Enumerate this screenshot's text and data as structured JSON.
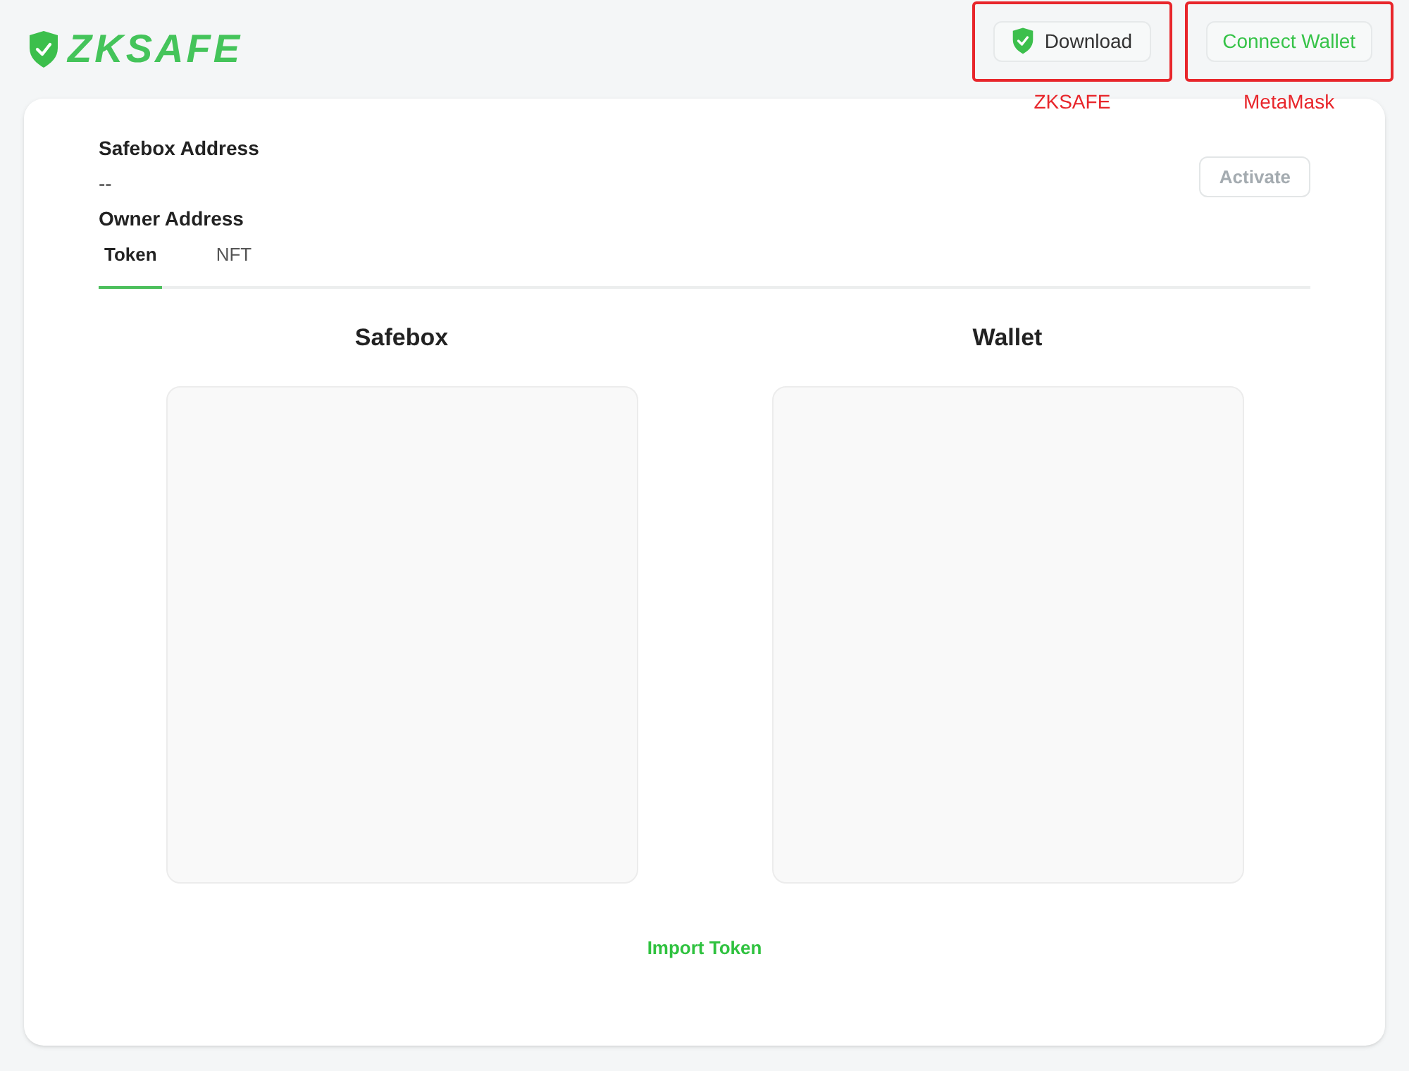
{
  "logo": {
    "text": "ZKSAFE"
  },
  "header_buttons": [
    {
      "kind": "download",
      "label": "Download",
      "annotation": "ZKSAFE"
    },
    {
      "kind": "connect",
      "label": "Connect Wallet",
      "annotation": "MetaMask"
    }
  ],
  "fields": [
    {
      "label": "Safebox Address",
      "value": "--"
    },
    {
      "label": "Owner Address"
    }
  ],
  "activate_button": {
    "label": "Activate",
    "disabled": true
  },
  "tabs": [
    {
      "label": "Token",
      "selected": true
    },
    {
      "label": "NFT",
      "selected": false
    }
  ],
  "panels": [
    {
      "title": "Safebox"
    },
    {
      "title": "Wallet"
    }
  ],
  "import_link": {
    "label": "Import Token"
  }
}
